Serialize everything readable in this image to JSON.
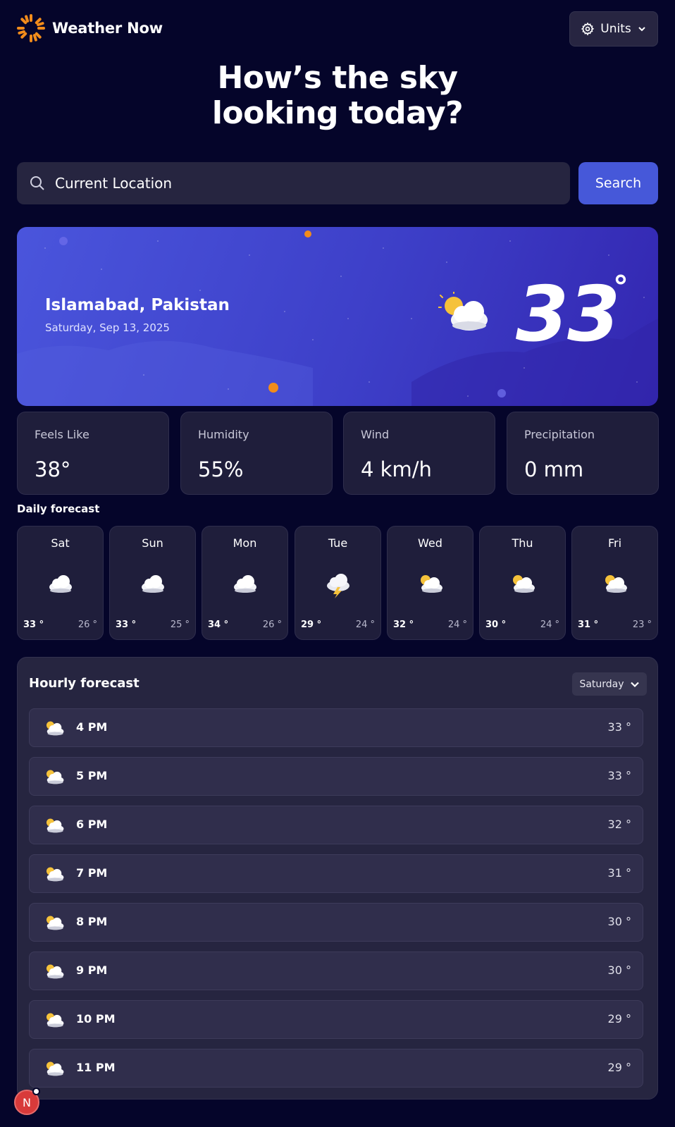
{
  "app": {
    "title": "Weather Now",
    "logo_icon": "sun-icon",
    "units_label": "Units",
    "headline_line1": "How’s the sky",
    "headline_line2": "looking today?"
  },
  "search": {
    "value": "",
    "placeholder": "Current Location",
    "button_label": "Search"
  },
  "current": {
    "location": "Islamabad, Pakistan",
    "date": "Saturday, Sep 13, 2025",
    "temp": "33",
    "degree_symbol": "°",
    "icon": "partly-cloudy-icon"
  },
  "stats": [
    {
      "label": "Feels Like",
      "value": "38°"
    },
    {
      "label": "Humidity",
      "value": "55%"
    },
    {
      "label": "Wind",
      "value": "4 km/h"
    },
    {
      "label": "Precipitation",
      "value": "0 mm"
    }
  ],
  "daily": {
    "title": "Daily forecast",
    "days": [
      {
        "name": "Sat",
        "icon": "cloud-icon",
        "hi": "33 °",
        "lo": "26 °"
      },
      {
        "name": "Sun",
        "icon": "cloud-icon",
        "hi": "33 °",
        "lo": "25 °"
      },
      {
        "name": "Mon",
        "icon": "cloud-icon",
        "hi": "34 °",
        "lo": "26 °"
      },
      {
        "name": "Tue",
        "icon": "storm-icon",
        "hi": "29 °",
        "lo": "24 °"
      },
      {
        "name": "Wed",
        "icon": "partly-cloudy-icon",
        "hi": "32 °",
        "lo": "24 °"
      },
      {
        "name": "Thu",
        "icon": "partly-cloudy-icon",
        "hi": "30 °",
        "lo": "24 °"
      },
      {
        "name": "Fri",
        "icon": "partly-cloudy-icon",
        "hi": "31 °",
        "lo": "23 °"
      }
    ]
  },
  "hourly": {
    "title": "Hourly forecast",
    "selected_day": "Saturday",
    "hours": [
      {
        "time": "4 PM",
        "temp": "33 °",
        "icon": "partly-cloudy-icon"
      },
      {
        "time": "5 PM",
        "temp": "33 °",
        "icon": "partly-cloudy-icon"
      },
      {
        "time": "6 PM",
        "temp": "32 °",
        "icon": "partly-cloudy-icon"
      },
      {
        "time": "7 PM",
        "temp": "31 °",
        "icon": "partly-cloudy-icon"
      },
      {
        "time": "8 PM",
        "temp": "30 °",
        "icon": "partly-cloudy-icon"
      },
      {
        "time": "9 PM",
        "temp": "30 °",
        "icon": "partly-cloudy-icon"
      },
      {
        "time": "10 PM",
        "temp": "29 °",
        "icon": "partly-cloudy-icon"
      },
      {
        "time": "11 PM",
        "temp": "29 °",
        "icon": "partly-cloudy-icon"
      }
    ]
  },
  "avatar": {
    "initial": "N"
  },
  "colors": {
    "background": "#05052a",
    "card": "#1f1e3b",
    "accent": "#4658d9",
    "hero_start": "#4a55dc",
    "hero_end": "#3326b0",
    "sun_orange": "#f28c1b"
  }
}
